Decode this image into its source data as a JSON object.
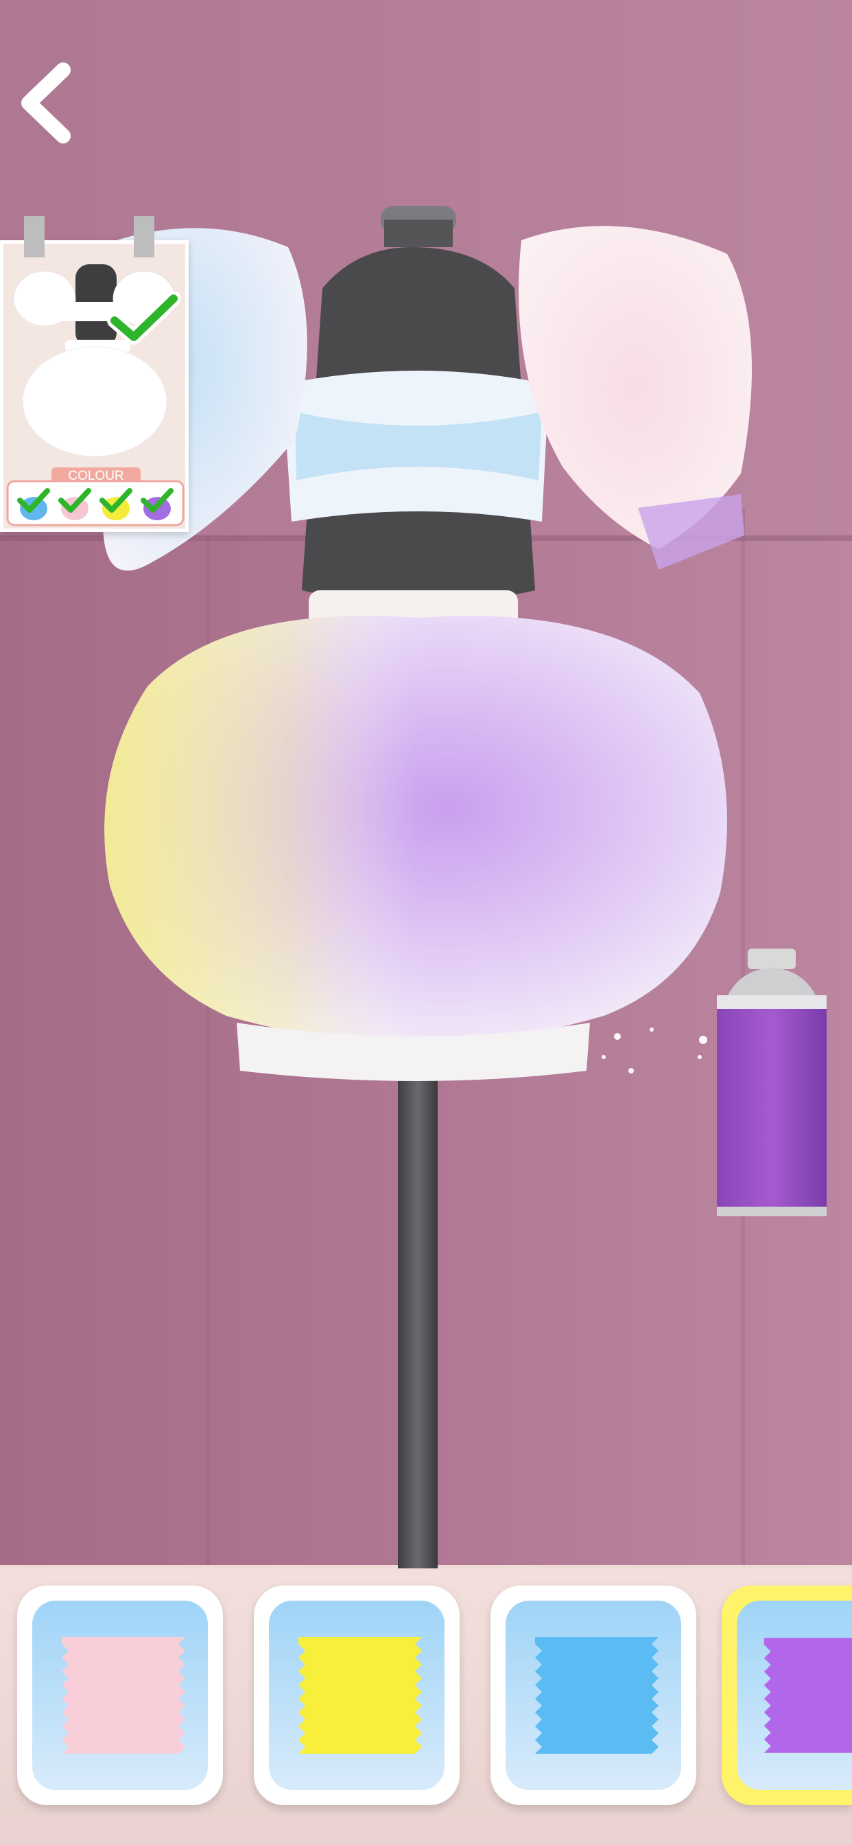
{
  "game": {
    "back_icon": "chevron-left-icon",
    "reference_card": {
      "label": "COLOUR",
      "check_icon": "check-icon",
      "color_checks": [
        {
          "color": "#62b6ee",
          "done": true
        },
        {
          "color": "#f6c7d2",
          "done": true
        },
        {
          "color": "#f4ec3a",
          "done": true
        },
        {
          "color": "#a46ee3",
          "done": true
        }
      ]
    },
    "spray_can": {
      "color": "#a55bcf"
    },
    "swatches": [
      {
        "name": "pink",
        "color": "#f8cfd9",
        "selected": false
      },
      {
        "name": "yellow",
        "color": "#f7ef3b",
        "selected": false
      },
      {
        "name": "blue",
        "color": "#5bbcf3",
        "selected": false
      },
      {
        "name": "purple",
        "color": "#b266ea",
        "selected": true
      }
    ],
    "colors": {
      "wall": "#a86f8a",
      "wall_light": "#c58aa3",
      "mannequin": "#4a4a4c",
      "stand": "#5d5d60",
      "floor": "#efdad7"
    }
  }
}
